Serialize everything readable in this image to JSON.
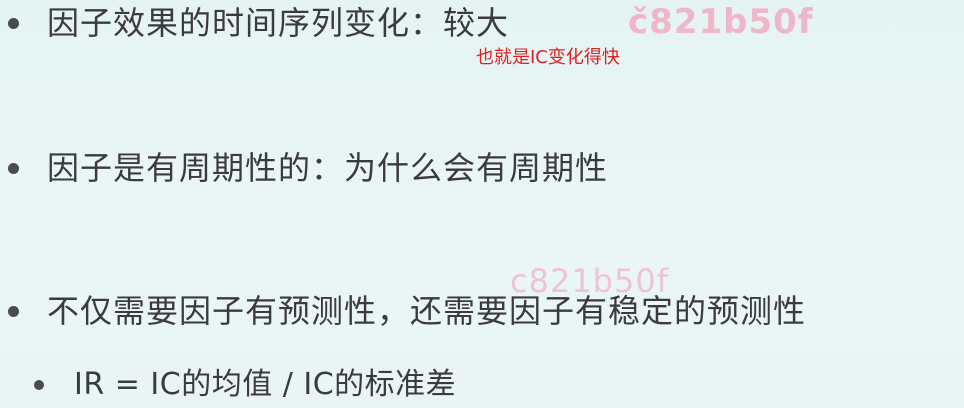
{
  "slide": {
    "bullets": [
      "因子效果的时间序列变化：较大",
      "因子是有周期性的：为什么会有周期性",
      "不仅需要因子有预测性，还需要因子有稳定的预测性"
    ],
    "sub_bullet": "IR = IC的均值 / IC的标准差",
    "annotation": "也就是IC变化得快",
    "watermarks": [
      "č821b50f",
      "c821b50f"
    ],
    "colors": {
      "background": "#e6f4f4",
      "text": "#3b3b3b",
      "annotation": "#e02020",
      "watermark": "#f2a3bc"
    }
  }
}
